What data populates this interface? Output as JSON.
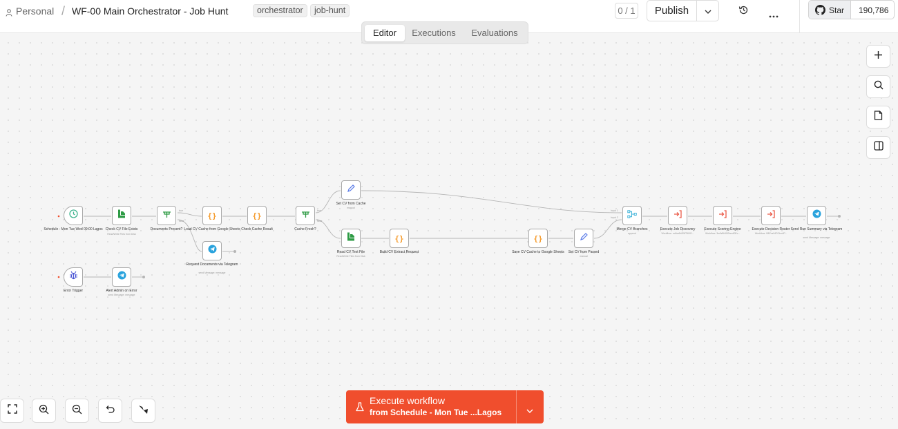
{
  "header": {
    "project": "Personal",
    "separator": "/",
    "workflow_name": "WF-00 Main Orchestrator - Job Hunt",
    "tags": [
      "orchestrator",
      "job-hunt"
    ],
    "counter": "0 / 1",
    "publish_label": "Publish",
    "github_star_label": "Star",
    "github_star_count": "190,786"
  },
  "tabs": [
    "Editor",
    "Executions",
    "Evaluations"
  ],
  "active_tab": "Editor",
  "nodes": [
    {
      "id": "schedule",
      "label": "Schedule - Mon Tue Wed 09:00 Lagos",
      "sub": "",
      "icon": "clock-icon"
    },
    {
      "id": "check_file",
      "label": "Check CV File Exists",
      "sub": "Read/Write Files from Disk",
      "icon": "file-icon"
    },
    {
      "id": "docs_present",
      "label": "Documents Present?",
      "sub": "",
      "icon": "if-icon"
    },
    {
      "id": "load_cache",
      "label": "Load CV Cache from Google Sheets",
      "sub": "",
      "icon": "code-icon"
    },
    {
      "id": "check_cache",
      "label": "Check Cache Result",
      "sub": "",
      "icon": "code-icon"
    },
    {
      "id": "cache_fresh",
      "label": "Cache Fresh?",
      "sub": "",
      "icon": "if-icon"
    },
    {
      "id": "set_cache",
      "label": "Set CV from Cache",
      "sub": "manual",
      "icon": "pencil-icon"
    },
    {
      "id": "read_cv",
      "label": "Read CV Text File",
      "sub": "Read/Write Files from Disk",
      "icon": "file-icon"
    },
    {
      "id": "build_cv",
      "label": "Build CV Extract Request",
      "sub": "",
      "icon": "code-icon"
    },
    {
      "id": "save_cache",
      "label": "Save CV Cache to Google Sheets",
      "sub": "",
      "icon": "code-icon"
    },
    {
      "id": "set_parsed",
      "label": "Set CV from Parsed",
      "sub": "manual",
      "icon": "pencil-icon"
    },
    {
      "id": "merge",
      "label": "Merge CV Branches",
      "sub": "append",
      "icon": "merge-icon"
    },
    {
      "id": "exec_discovery",
      "label": "Execute Job Discovery",
      "sub": "Workflow: m4be6b2l5fT6l0O...",
      "icon": "execute-icon"
    },
    {
      "id": "exec_scoring",
      "label": "Execute Scoring Engine",
      "sub": "Workflow: 3mW6l4l0Gbm40Ev...",
      "icon": "execute-icon"
    },
    {
      "id": "exec_router",
      "label": "Execute Decision Router",
      "sub": "Workflow: 0l8Yra94FGkmJP...",
      "icon": "execute-icon"
    },
    {
      "id": "send_summary",
      "label": "Send Run Summary via Telegram",
      "sub": "send Message: message",
      "icon": "telegram-icon"
    },
    {
      "id": "request_docs",
      "label": "Request Documents via Telegram",
      "sub": "send Message: message",
      "icon": "telegram-icon"
    },
    {
      "id": "error_trigger",
      "label": "Error Trigger",
      "sub": "",
      "icon": "bug-icon"
    },
    {
      "id": "alert_admin",
      "label": "Alert Admin on Error",
      "sub": "send Message: message",
      "icon": "telegram-icon"
    }
  ],
  "branch_labels": {
    "true": "true",
    "false": "false",
    "input1": "Input 1",
    "input2": "Input 2"
  },
  "execute": {
    "title": "Execute workflow",
    "subtitle": "from Schedule - Mon Tue ...Lagos"
  },
  "colors": {
    "accent": "#f04e2d",
    "trigger": "#3fb58f",
    "if": "#2e9b45",
    "code": "#f59b2c",
    "pencil": "#5b7ce8",
    "merge": "#3ab1d8",
    "execute": "#ea5a48",
    "telegram": "#2aa3dd",
    "bug": "#4a55d4"
  }
}
